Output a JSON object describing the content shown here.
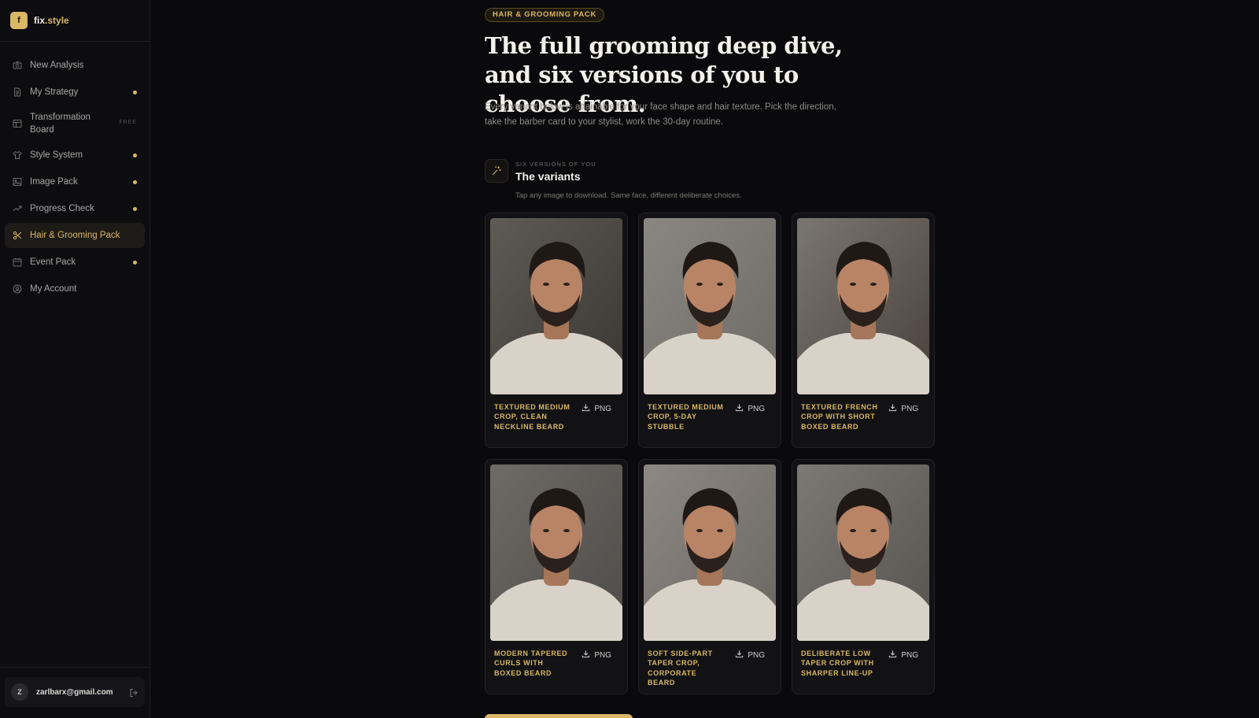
{
  "brand": {
    "logo_letter": "f",
    "name_main": "fix",
    "name_accent": ".style",
    "accent_color": "#d9b765"
  },
  "sidebar": {
    "items": [
      {
        "label": "New Analysis",
        "icon": "camera-icon",
        "dot": false
      },
      {
        "label": "My Strategy",
        "icon": "document-icon",
        "dot": true
      },
      {
        "label": "Transformation Board",
        "icon": "board-icon",
        "tag": "FREE"
      },
      {
        "label": "Style System",
        "icon": "shirt-icon",
        "dot": true
      },
      {
        "label": "Image Pack",
        "icon": "image-icon",
        "dot": true
      },
      {
        "label": "Progress Check",
        "icon": "trend-icon",
        "dot": true
      },
      {
        "label": "Hair & Grooming Pack",
        "icon": "scissors-icon",
        "active": true
      },
      {
        "label": "Event Pack",
        "icon": "calendar-icon",
        "dot": true
      },
      {
        "label": "My Account",
        "icon": "user-circle-icon",
        "dot": false
      }
    ]
  },
  "account": {
    "avatar_letter": "Z",
    "email": "zarlbarx@gmail.com"
  },
  "main": {
    "badge": "HAIR & GROOMING PACK",
    "headline": "The full grooming deep dive, and six versions of you to choose from.",
    "intro": "Every variant below is attainable for your face shape and hair texture. Pick the direction, take the barber card to your stylist, work the 30-day routine.",
    "section": {
      "eyebrow": "SIX VERSIONS OF YOU",
      "title": "The variants",
      "subtitle": "Tap any image to download. Same face, different deliberate choices."
    },
    "download_label": "PNG",
    "variants": [
      {
        "caption": "TEXTURED MEDIUM CROP, CLEAN NECKLINE BEARD"
      },
      {
        "caption": "TEXTURED MEDIUM CROP, 5-DAY STUBBLE"
      },
      {
        "caption": "TEXTURED FRENCH CROP WITH SHORT BOXED BEARD"
      },
      {
        "caption": "MODERN TAPERED CURLS WITH BOXED BEARD"
      },
      {
        "caption": "SOFT SIDE-PART TAPER CROP, CORPORATE BEARD"
      },
      {
        "caption": "DELIBERATE LOW TAPER CROP WITH SHARPER LINE-UP"
      }
    ]
  }
}
